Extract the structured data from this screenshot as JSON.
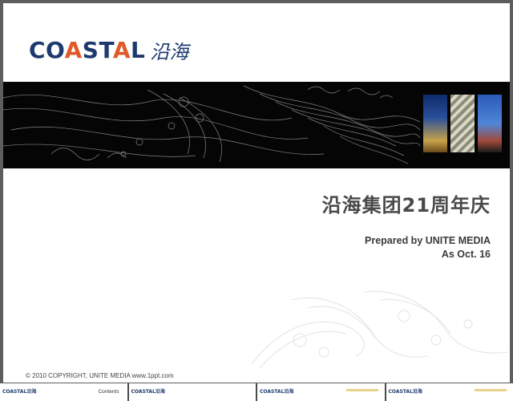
{
  "logo": {
    "text_1": "CO",
    "text_a": "A",
    "text_2": "ST",
    "text_a2": "A",
    "text_3": "L",
    "text_cn": "沿海",
    "accent": "#e0592a",
    "brand": "#1d3a6e"
  },
  "slide": {
    "title": "沿海集团21周年庆",
    "prepared_by": "Prepared by UNITE MEDIA",
    "date": "As Oct. 16",
    "copyright": "© 2010 COPYRIGHT, UNITE MEDIA www.1ppt.com"
  },
  "thumbnails": [
    {
      "logo": "COASTAL沿海",
      "label": "Contents"
    },
    {
      "logo": "COASTAL沿海",
      "label": ""
    },
    {
      "logo": "COASTAL沿海",
      "label": ""
    },
    {
      "logo": "COASTAL沿海",
      "label": ""
    }
  ]
}
